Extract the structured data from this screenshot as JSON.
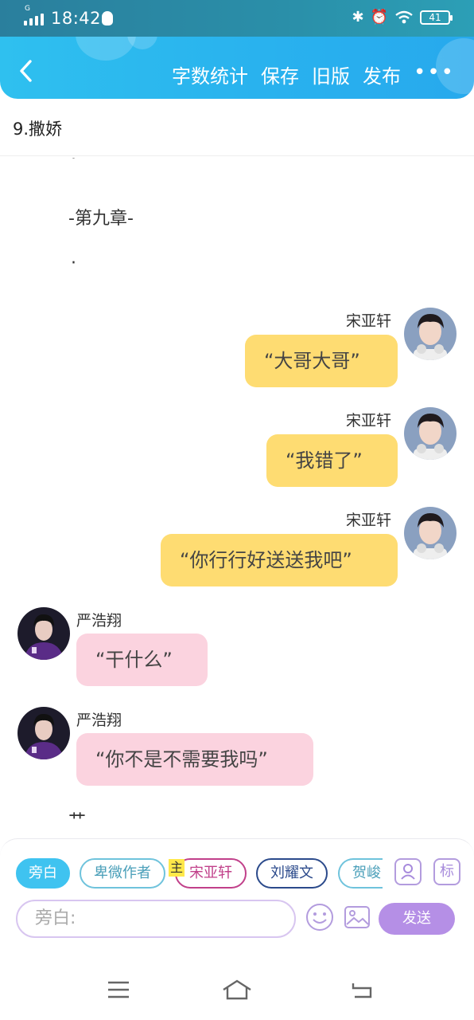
{
  "status": {
    "time": "18:42",
    "net": "G",
    "battery": "41"
  },
  "nav": {
    "back_icon": "chevron-left-icon",
    "actions": [
      "字数统计",
      "保存",
      "旧版",
      "发布"
    ],
    "more": "•••"
  },
  "chapter": {
    "title": "9.撒娇"
  },
  "story": {
    "dot1": "·",
    "heading": "-第九章-",
    "dot2": "·",
    "trailing": "艹",
    "messages": [
      {
        "speaker": "宋亚轩",
        "text": "“大哥大哥”",
        "side": "right",
        "color": "#fedc72"
      },
      {
        "speaker": "宋亚轩",
        "text": "“我错了”",
        "side": "right",
        "color": "#fedc72"
      },
      {
        "speaker": "宋亚轩",
        "text": "“你行行好送送我吧”",
        "side": "right",
        "color": "#fedc72"
      },
      {
        "speaker": "严浩翔",
        "text": "“干什么”",
        "side": "left",
        "color": "#fbd3df"
      },
      {
        "speaker": "严浩翔",
        "text": "“你不是不需要我吗”",
        "side": "left",
        "color": "#fbd3df"
      }
    ]
  },
  "composer": {
    "chips": [
      "旁白",
      "卑微作者",
      "宋亚轩",
      "刘耀文",
      "贺峻"
    ],
    "main_tag": "主",
    "label_btn": "标",
    "placeholder": "旁白:",
    "send": "发送"
  },
  "colors": {
    "accent": "#29b2ee",
    "send": "#b58fe6",
    "yellow_bubble": "#fedc72",
    "pink_bubble": "#fbd3df"
  }
}
